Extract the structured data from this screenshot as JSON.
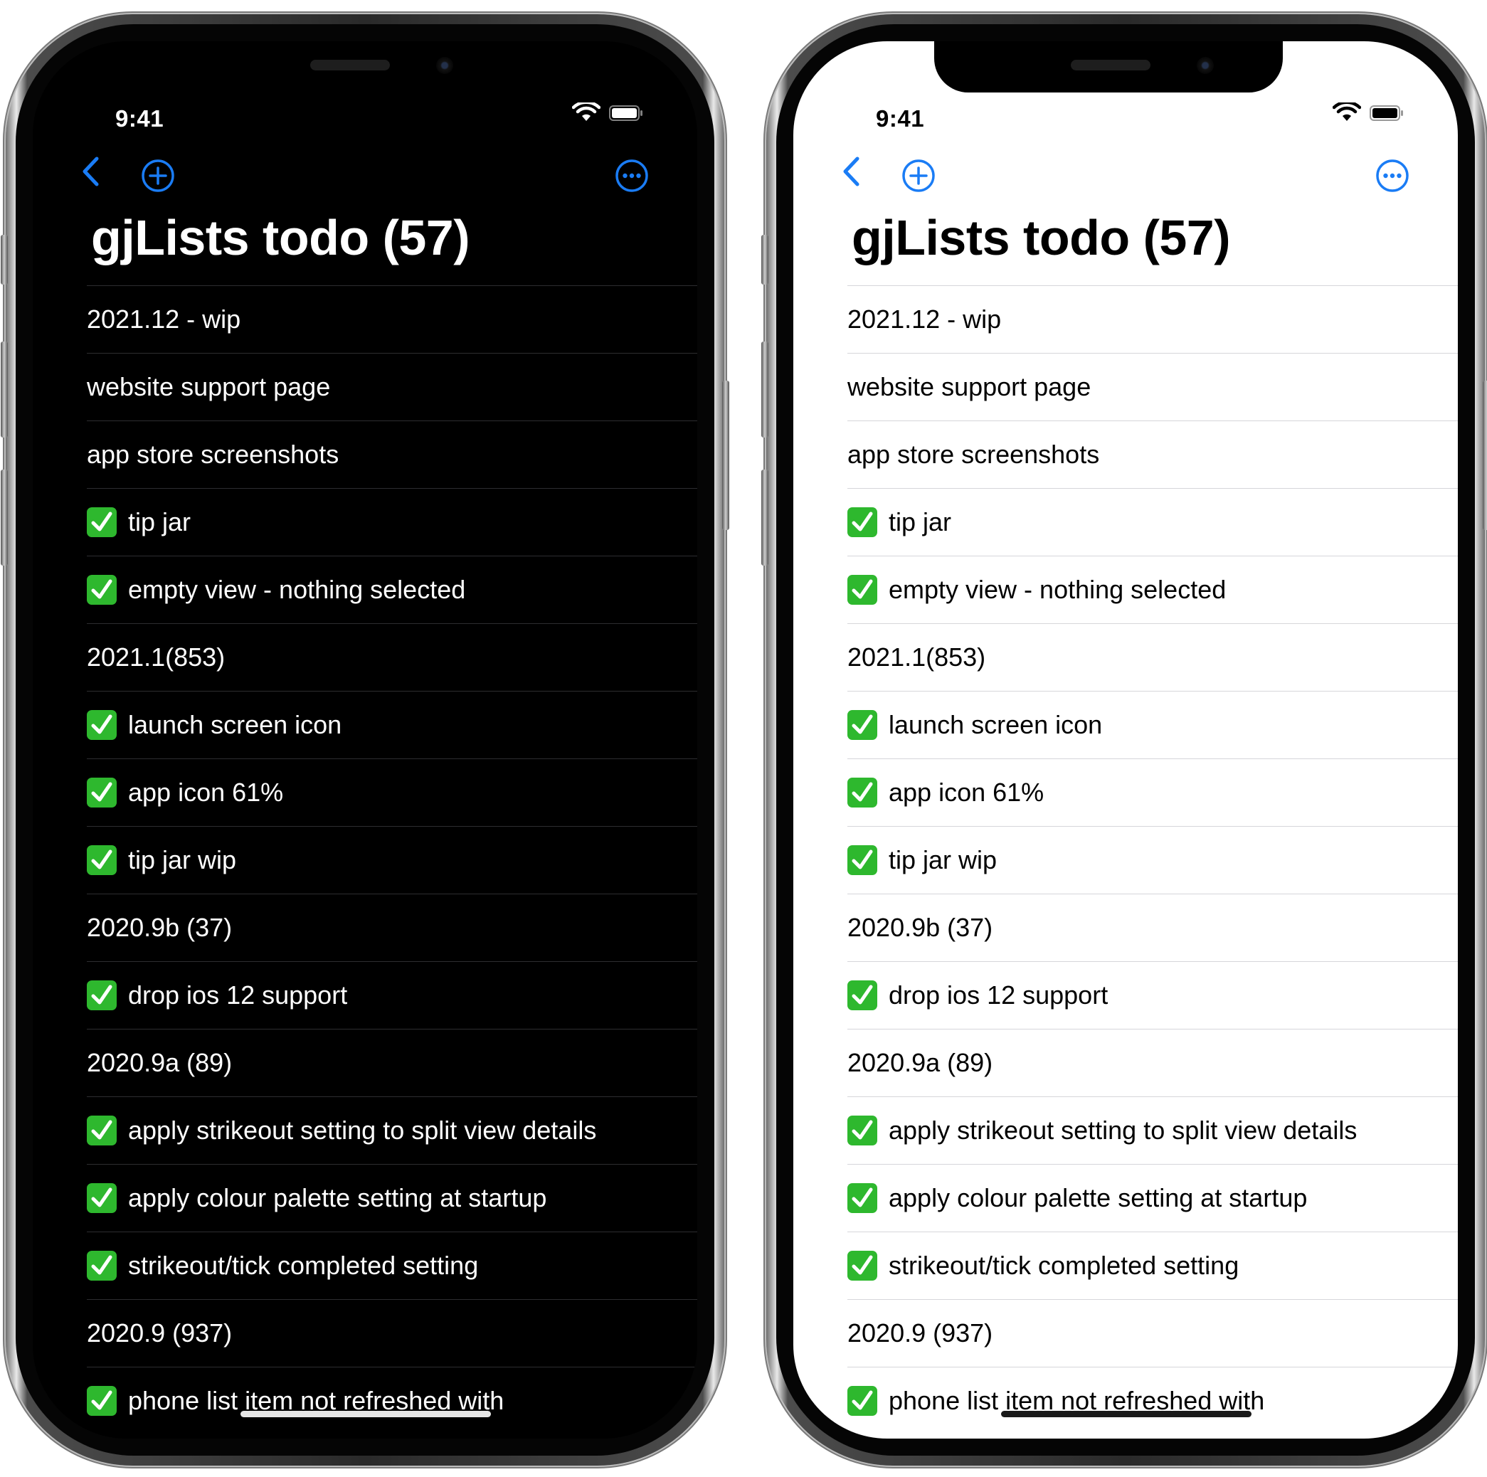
{
  "status": {
    "time": "9:41"
  },
  "nav": {
    "back_icon": "chevron-left-icon",
    "add_icon": "plus-circle-icon",
    "more_icon": "ellipsis-circle-icon"
  },
  "accent_color": "#1a7cf5",
  "check_color": "#2eb82e",
  "list_title": "gjLists todo (57)",
  "items": [
    {
      "text": "2021.12 - wip",
      "done": false
    },
    {
      "text": "website support page",
      "done": false
    },
    {
      "text": "app store screenshots",
      "done": false
    },
    {
      "text": "tip jar",
      "done": true
    },
    {
      "text": "empty view - nothing selected",
      "done": true
    },
    {
      "text": "2021.1(853)",
      "done": false
    },
    {
      "text": "launch screen icon",
      "done": true
    },
    {
      "text": "app icon 61%",
      "done": true
    },
    {
      "text": "tip jar wip",
      "done": true
    },
    {
      "text": "2020.9b (37)",
      "done": false
    },
    {
      "text": "drop ios 12 support",
      "done": true
    },
    {
      "text": "2020.9a (89)",
      "done": false
    },
    {
      "text": "apply strikeout setting to split view details",
      "done": true
    },
    {
      "text": "apply colour palette setting at startup",
      "done": true
    },
    {
      "text": "strikeout/tick completed setting",
      "done": true
    },
    {
      "text": "2020.9 (937)",
      "done": false
    },
    {
      "text": "phone list item not refreshed with",
      "done": true
    }
  ]
}
